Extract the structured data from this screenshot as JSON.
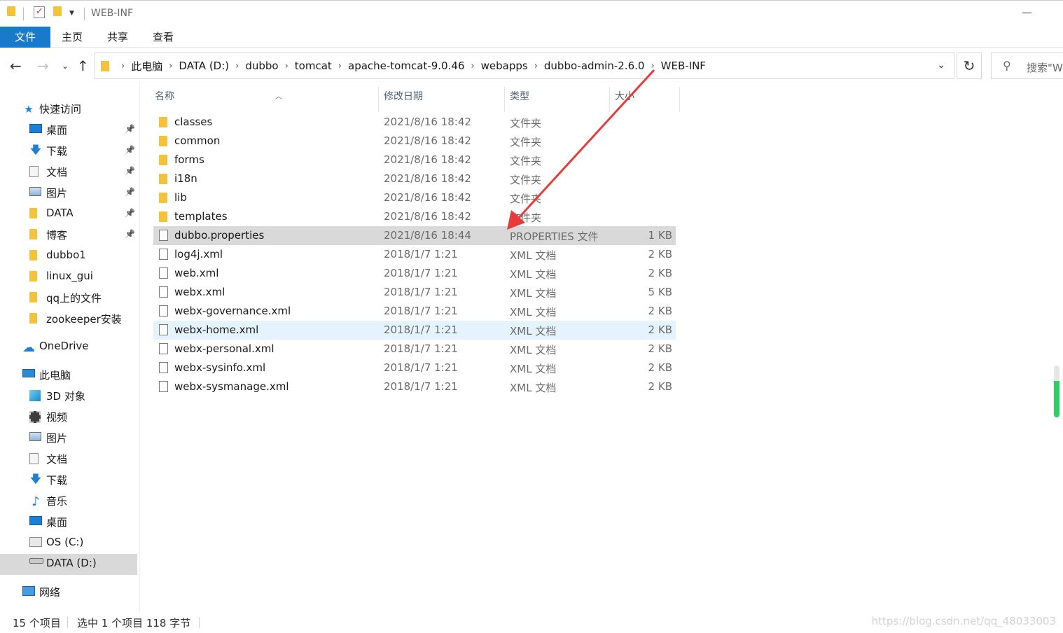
{
  "window": {
    "title": "WEB-INF"
  },
  "ribbon": {
    "tabs": [
      {
        "label": "文件"
      },
      {
        "label": "主页"
      },
      {
        "label": "共享"
      },
      {
        "label": "查看"
      }
    ]
  },
  "address": {
    "breadcrumbs": [
      "此电脑",
      "DATA (D:)",
      "dubbo",
      "tomcat",
      "apache-tomcat-9.0.46",
      "webapps",
      "dubbo-admin-2.6.0",
      "WEB-INF"
    ]
  },
  "search": {
    "placeholder": "搜索\"W"
  },
  "sidebar": {
    "quick_access": "快速访问",
    "quick_items": [
      {
        "label": "桌面",
        "icon": "desktop-icon",
        "pinned": true
      },
      {
        "label": "下载",
        "icon": "download-icon",
        "pinned": true
      },
      {
        "label": "文档",
        "icon": "document-icon",
        "pinned": true
      },
      {
        "label": "图片",
        "icon": "pictures-icon",
        "pinned": true
      },
      {
        "label": "DATA",
        "icon": "folder-icon",
        "pinned": true
      },
      {
        "label": "博客",
        "icon": "folder-icon",
        "pinned": true
      },
      {
        "label": "dubbo1",
        "icon": "folder-icon",
        "pinned": false
      },
      {
        "label": "linux_gui",
        "icon": "folder-icon",
        "pinned": false
      },
      {
        "label": "qq上的文件",
        "icon": "folder-icon",
        "pinned": false
      },
      {
        "label": "zookeeper安装",
        "icon": "folder-icon",
        "pinned": false
      }
    ],
    "onedrive": "OneDrive",
    "this_pc": "此电脑",
    "pc_items": [
      {
        "label": "3D 对象",
        "icon": "3d-objects-icon"
      },
      {
        "label": "视频",
        "icon": "video-icon"
      },
      {
        "label": "图片",
        "icon": "pictures-icon"
      },
      {
        "label": "文档",
        "icon": "document-icon"
      },
      {
        "label": "下载",
        "icon": "download-icon"
      },
      {
        "label": "音乐",
        "icon": "music-icon"
      },
      {
        "label": "桌面",
        "icon": "desktop-icon"
      },
      {
        "label": "OS (C:)",
        "icon": "os-drive-icon"
      },
      {
        "label": "DATA (D:)",
        "icon": "drive-icon"
      }
    ],
    "network": "网络"
  },
  "columns": {
    "name": "名称",
    "date": "修改日期",
    "type": "类型",
    "size": "大小"
  },
  "files": [
    {
      "name": "classes",
      "date": "2021/8/16 18:42",
      "type": "文件夹",
      "size": "",
      "kind": "folder"
    },
    {
      "name": "common",
      "date": "2021/8/16 18:42",
      "type": "文件夹",
      "size": "",
      "kind": "folder"
    },
    {
      "name": "forms",
      "date": "2021/8/16 18:42",
      "type": "文件夹",
      "size": "",
      "kind": "folder"
    },
    {
      "name": "i18n",
      "date": "2021/8/16 18:42",
      "type": "文件夹",
      "size": "",
      "kind": "folder"
    },
    {
      "name": "lib",
      "date": "2021/8/16 18:42",
      "type": "文件夹",
      "size": "",
      "kind": "folder"
    },
    {
      "name": "templates",
      "date": "2021/8/16 18:42",
      "type": "文件夹",
      "size": "",
      "kind": "folder"
    },
    {
      "name": "dubbo.properties",
      "date": "2021/8/16 18:44",
      "type": "PROPERTIES 文件",
      "size": "1 KB",
      "kind": "file"
    },
    {
      "name": "log4j.xml",
      "date": "2018/1/7 1:21",
      "type": "XML 文档",
      "size": "2 KB",
      "kind": "file"
    },
    {
      "name": "web.xml",
      "date": "2018/1/7 1:21",
      "type": "XML 文档",
      "size": "2 KB",
      "kind": "file"
    },
    {
      "name": "webx.xml",
      "date": "2018/1/7 1:21",
      "type": "XML 文档",
      "size": "5 KB",
      "kind": "file"
    },
    {
      "name": "webx-governance.xml",
      "date": "2018/1/7 1:21",
      "type": "XML 文档",
      "size": "2 KB",
      "kind": "file"
    },
    {
      "name": "webx-home.xml",
      "date": "2018/1/7 1:21",
      "type": "XML 文档",
      "size": "2 KB",
      "kind": "file"
    },
    {
      "name": "webx-personal.xml",
      "date": "2018/1/7 1:21",
      "type": "XML 文档",
      "size": "2 KB",
      "kind": "file"
    },
    {
      "name": "webx-sysinfo.xml",
      "date": "2018/1/7 1:21",
      "type": "XML 文档",
      "size": "2 KB",
      "kind": "file"
    },
    {
      "name": "webx-sysmanage.xml",
      "date": "2018/1/7 1:21",
      "type": "XML 文档",
      "size": "2 KB",
      "kind": "file"
    }
  ],
  "selected_file": "dubbo.properties",
  "hovered_file": "webx-home.xml",
  "status": {
    "count": "15 个项目",
    "selection": "选中 1 个项目  118 字节"
  },
  "watermark": "https://blog.csdn.net/qq_48033003",
  "colors": {
    "accent": "#1979ca",
    "folder": "#f4c33c",
    "selection": "#d9d9d9",
    "hover": "#e5f3ff",
    "annotation_arrow": "#e83b3b"
  }
}
